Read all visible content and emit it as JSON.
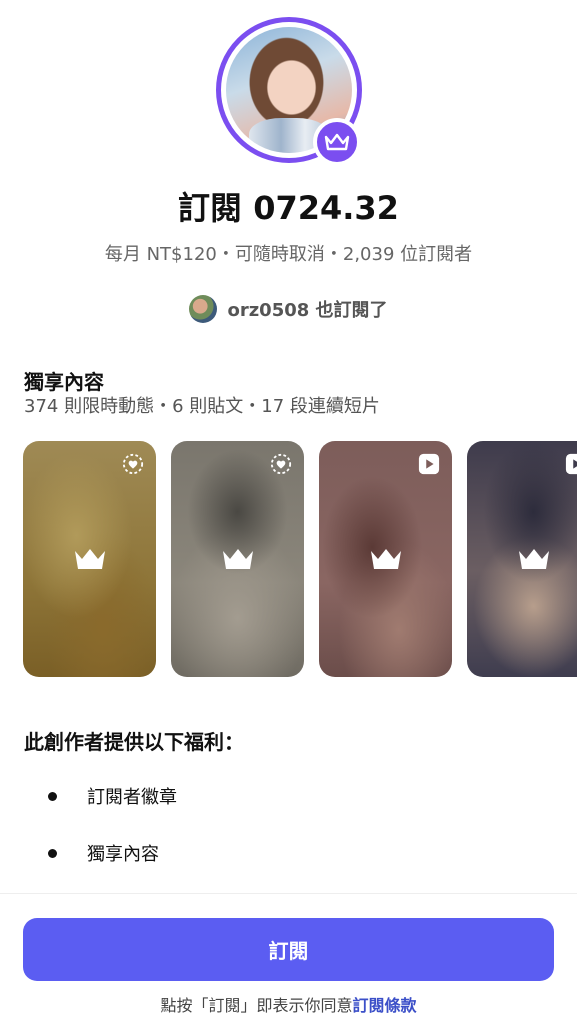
{
  "header": {
    "title": "訂閱 0724.32",
    "subtitle": "每月 NT$120・可隨時取消・2,039 位訂閱者",
    "also_subscribed": "orz0508 也訂閱了"
  },
  "exclusive": {
    "title": "獨享內容",
    "summary": "374 則限時動態・6 則貼文・17 段連續短片",
    "items": [
      {
        "type": "story",
        "icon": "story-heart-icon"
      },
      {
        "type": "story",
        "icon": "story-heart-icon"
      },
      {
        "type": "clip",
        "icon": "play-icon"
      },
      {
        "type": "clip",
        "icon": "play-icon"
      }
    ]
  },
  "benefits": {
    "title": "此創作者提供以下福利：",
    "items": [
      "訂閱者徽章",
      "獨享內容"
    ]
  },
  "cta": {
    "subscribe_label": "訂閱"
  },
  "terms": {
    "prefix": "點按「訂閱」即表示你同意",
    "link": "訂閱條款"
  },
  "colors": {
    "accent": "#5b5df2",
    "ring": "#7b4ef0"
  }
}
